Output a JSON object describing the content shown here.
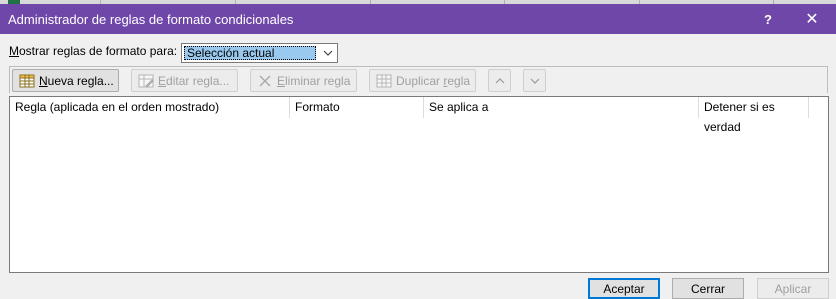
{
  "window": {
    "title": "Administrador de reglas de formato condicionales",
    "help_label": "?",
    "close_label": "✕",
    "accent_color": "#6f47a8"
  },
  "filter": {
    "label_prefix": "M",
    "label_rest": "ostrar reglas de formato para:",
    "selected_value": "Selección actual"
  },
  "toolbar": {
    "new_rule_prefix": "N",
    "new_rule_rest": "ueva regla...",
    "edit_rule_prefix": "E",
    "edit_rule_rest": "ditar regla...",
    "delete_rule_prefix": "E",
    "delete_rule_rest": "liminar regla",
    "duplicate_rule_prefix": "Duplicar ",
    "duplicate_rule_underline": "r",
    "duplicate_rule_rest": "egla"
  },
  "table": {
    "columns": [
      "Regla (aplicada en el orden mostrado)",
      "Formato",
      "Se aplica a",
      "Detener si es verdad"
    ],
    "rows": []
  },
  "footer": {
    "ok_label": "Aceptar",
    "close_label": "Cerrar",
    "apply_label": "Aplicar"
  }
}
